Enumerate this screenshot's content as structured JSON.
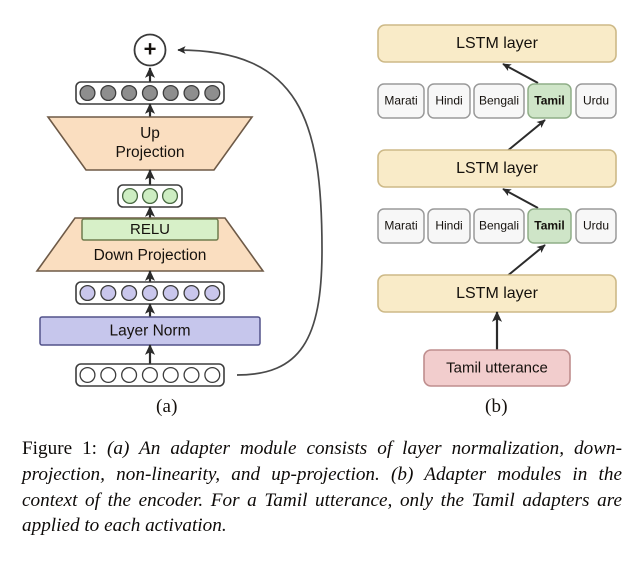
{
  "figure": {
    "caption_head": "Figure 1:",
    "caption_body": "(a) An adapter module consists of layer normalization, down-projection, non-linearity, and up-projection. (b) Adapter modules in the context of the encoder. For a Tamil utterance, only the Tamil adapters are applied to each activation.",
    "panel_a_label": "(a)",
    "panel_b_label": "(b)"
  },
  "colors": {
    "projection_fill": "#fadec0",
    "projection_stroke": "#7b6550",
    "relu_fill": "#d7f0c8",
    "relu_stroke": "#7f8a5c",
    "layernorm_fill": "#c6c6ec",
    "layernorm_stroke": "#5a5a86",
    "gray_node": "#8e8e8e",
    "green_node": "#cdeec2",
    "purple_node": "#c9c6ec",
    "white_node": "#ffffff",
    "node_stroke": "#3d3d3d",
    "lstm_fill": "#f9ebc8",
    "lstm_stroke": "#cdb987",
    "adapter_fill": "#f7f7f7",
    "adapter_stroke": "#9a9a9a",
    "adapter_active_fill": "#cfe5c8",
    "adapter_active_stroke": "#8fae87",
    "utterance_fill": "#f2cdcd",
    "utterance_stroke": "#bf8e8e",
    "arrow": "#2b2b2b"
  },
  "panel_a": {
    "sum_node_label": "+",
    "output_nodes": {
      "count": 7,
      "fill_name": "gray"
    },
    "up_projection_label_line1": "Up",
    "up_projection_label_line2": "Projection",
    "bottleneck_nodes": {
      "count": 3,
      "fill_name": "green"
    },
    "relu_label": "RELU",
    "down_projection_label": "Down Projection",
    "normed_nodes": {
      "count": 7,
      "fill_name": "purple"
    },
    "layer_norm_label": "Layer Norm",
    "input_nodes": {
      "count": 7,
      "fill_name": "white"
    },
    "residual_connection": "skip-connection from input row to sum node"
  },
  "panel_b": {
    "lstm_layers": [
      {
        "label": "LSTM layer"
      },
      {
        "label": "LSTM layer"
      },
      {
        "label": "LSTM layer"
      }
    ],
    "adapter_rows": [
      {
        "adapters": [
          {
            "label": "Marati",
            "active": false
          },
          {
            "label": "Hindi",
            "active": false
          },
          {
            "label": "Bengali",
            "active": false
          },
          {
            "label": "Tamil",
            "active": true
          },
          {
            "label": "Urdu",
            "active": false
          }
        ]
      },
      {
        "adapters": [
          {
            "label": "Marati",
            "active": false
          },
          {
            "label": "Hindi",
            "active": false
          },
          {
            "label": "Bengali",
            "active": false
          },
          {
            "label": "Tamil",
            "active": true
          },
          {
            "label": "Urdu",
            "active": false
          }
        ]
      }
    ],
    "input_box_label": "Tamil utterance"
  }
}
